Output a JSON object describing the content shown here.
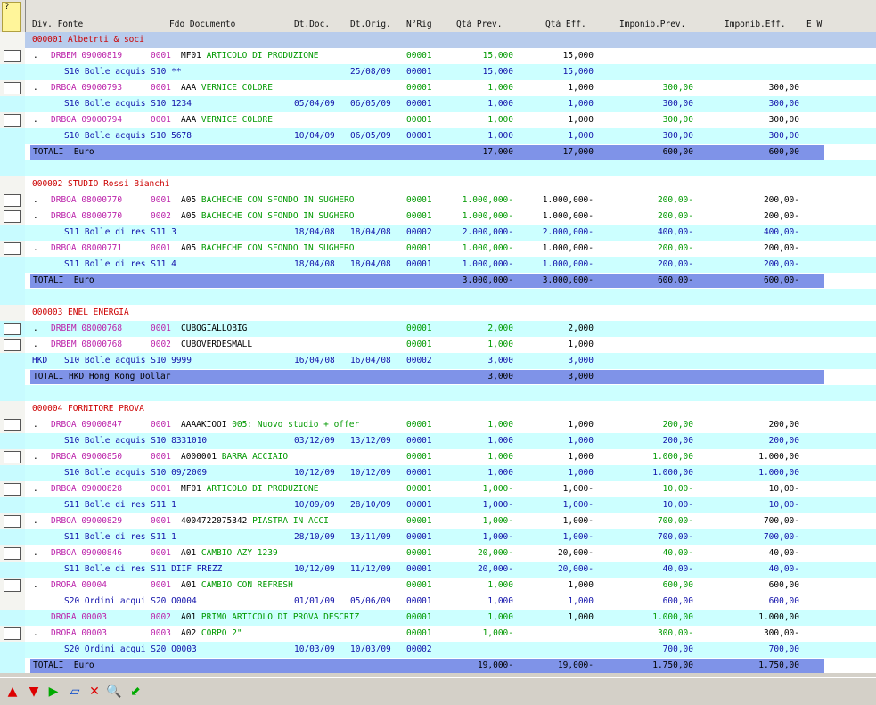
{
  "corner": "?",
  "columns": {
    "div_fonte": "Div. Fonte",
    "fdo_documento": "Fdo Documento",
    "dt_doc": "Dt.Doc.",
    "dt_orig": "Dt.Orig.",
    "n_rig": "N°Rig",
    "qta_prev": "Qtà Prev.",
    "qta_eff": "Qtà Eff.",
    "imponib_prev": "Imponib.Prev.",
    "imponib_eff": "Imponib.Eff.",
    "e_w": "E W"
  },
  "rows": [
    {
      "type": "group",
      "title": "000001 Albetrti & soci"
    },
    {
      "type": "detail",
      "bg": "white",
      "cb": true,
      "dot": ".",
      "fonte": "DRBEM 09000819",
      "rig": "0001",
      "art": "MF01",
      "desc": "ARTICOLO DI PRODUZIONE",
      "nrig": "00001",
      "qprev": "15,000",
      "qeff": "15,000",
      "iprev": "",
      "ieff": ""
    },
    {
      "type": "sub",
      "bg": "cyan",
      "div": "",
      "doc": "S10 Bolle acquis S10 **",
      "dtdoc": "",
      "dtorig": "25/08/09",
      "nrig": "00001",
      "qprev": "15,000",
      "qeff": "15,000",
      "iprev": "",
      "ieff": ""
    },
    {
      "type": "detail",
      "bg": "white",
      "cb": true,
      "dot": ".",
      "fonte": "DRBOA 09000793",
      "rig": "0001",
      "art": "AAA",
      "desc": "VERNICE COLORE",
      "nrig": "00001",
      "qprev": "1,000",
      "qeff": "1,000",
      "iprev": "300,00",
      "ieff": "300,00"
    },
    {
      "type": "sub",
      "bg": "cyan",
      "div": "",
      "doc": "S10 Bolle acquis S10 1234",
      "dtdoc": "05/04/09",
      "dtorig": "06/05/09",
      "nrig": "00001",
      "qprev": "1,000",
      "qeff": "1,000",
      "iprev": "300,00",
      "ieff": "300,00"
    },
    {
      "type": "detail",
      "bg": "white",
      "cb": true,
      "dot": ".",
      "fonte": "DRBOA 09000794",
      "rig": "0001",
      "art": "AAA",
      "desc": "VERNICE COLORE",
      "nrig": "00001",
      "qprev": "1,000",
      "qeff": "1,000",
      "iprev": "300,00",
      "ieff": "300,00"
    },
    {
      "type": "sub",
      "bg": "cyan",
      "div": "",
      "doc": "S10 Bolle acquis S10 5678",
      "dtdoc": "10/04/09",
      "dtorig": "06/05/09",
      "nrig": "00001",
      "qprev": "1,000",
      "qeff": "1,000",
      "iprev": "300,00",
      "ieff": "300,00"
    },
    {
      "type": "total",
      "label": "TOTALI  Euro",
      "qprev": "17,000",
      "qeff": "17,000",
      "iprev": "600,00",
      "ieff": "600,00"
    },
    {
      "type": "blank",
      "bg": "cyan"
    },
    {
      "type": "group2",
      "title": "000002 STUDIO Rossi Bianchi"
    },
    {
      "type": "detail",
      "bg": "white",
      "cb": true,
      "dot": ".",
      "fonte": "DRBOA 08000770",
      "rig": "0001",
      "art": "A05",
      "desc": "BACHECHE CON SFONDO IN SUGHERO",
      "nrig": "00001",
      "qprev": "1.000,000-",
      "qeff": "1.000,000-",
      "iprev": "200,00-",
      "ieff": "200,00-"
    },
    {
      "type": "detail",
      "bg": "white",
      "cb": true,
      "dot": ".",
      "fonte": "DRBOA 08000770",
      "rig": "0002",
      "art": "A05",
      "desc": "BACHECHE CON SFONDO IN SUGHERO",
      "nrig": "00001",
      "qprev": "1.000,000-",
      "qeff": "1.000,000-",
      "iprev": "200,00-",
      "ieff": "200,00-"
    },
    {
      "type": "sub",
      "bg": "cyan",
      "div": "",
      "doc": "S11 Bolle di res S11 3",
      "dtdoc": "18/04/08",
      "dtorig": "18/04/08",
      "nrig": "00002",
      "qprev": "2.000,000-",
      "qeff": "2.000,000-",
      "iprev": "400,00-",
      "ieff": "400,00-"
    },
    {
      "type": "detail",
      "bg": "white",
      "cb": true,
      "dot": ".",
      "fonte": "DRBOA 08000771",
      "rig": "0001",
      "art": "A05",
      "desc": "BACHECHE CON SFONDO IN SUGHERO",
      "nrig": "00001",
      "qprev": "1.000,000-",
      "qeff": "1.000,000-",
      "iprev": "200,00-",
      "ieff": "200,00-"
    },
    {
      "type": "sub",
      "bg": "cyan",
      "div": "",
      "doc": "S11 Bolle di res S11 4",
      "dtdoc": "18/04/08",
      "dtorig": "18/04/08",
      "nrig": "00001",
      "qprev": "1.000,000-",
      "qeff": "1.000,000-",
      "iprev": "200,00-",
      "ieff": "200,00-"
    },
    {
      "type": "total",
      "label": "TOTALI  Euro",
      "qprev": "3.000,000-",
      "qeff": "3.000,000-",
      "iprev": "600,00-",
      "ieff": "600,00-"
    },
    {
      "type": "blank",
      "bg": "cyan"
    },
    {
      "type": "group2",
      "title": "000003 ENEL ENERGIA"
    },
    {
      "type": "detail",
      "bg": "cyan",
      "cb": true,
      "dot": ".",
      "fonte": "DRBEM 08000768",
      "rig": "0001",
      "art": "CUBOGIALLOBIG",
      "desc": "",
      "nrig": "00001",
      "qprev": "2,000",
      "qeff": "2,000",
      "iprev": "",
      "ieff": ""
    },
    {
      "type": "detail",
      "bg": "white",
      "cb": true,
      "dot": ".",
      "fonte": "DRBEM 08000768",
      "rig": "0002",
      "art": "CUBOVERDESMALL",
      "desc": "",
      "nrig": "00001",
      "qprev": "1,000",
      "qeff": "1,000",
      "iprev": "",
      "ieff": ""
    },
    {
      "type": "sub",
      "bg": "cyan",
      "div": "HKD",
      "doc": "S10 Bolle acquis S10 9999",
      "dtdoc": "16/04/08",
      "dtorig": "16/04/08",
      "nrig": "00002",
      "qprev": "3,000",
      "qeff": "3,000",
      "iprev": "",
      "ieff": ""
    },
    {
      "type": "total",
      "label": "TOTALI HKD Hong Kong Dollar",
      "qprev": "3,000",
      "qeff": "3,000",
      "iprev": "",
      "ieff": ""
    },
    {
      "type": "blank",
      "bg": "cyan"
    },
    {
      "type": "group2",
      "title": "000004 FORNITORE PROVA"
    },
    {
      "type": "detail",
      "bg": "white",
      "cb": true,
      "dot": ".",
      "fonte": "DRBOA 09000847",
      "rig": "0001",
      "art": "AAAAKIOOI",
      "desc": "005: Nuovo studio + offer",
      "nrig": "00001",
      "qprev": "1,000",
      "qeff": "1,000",
      "iprev": "200,00",
      "ieff": "200,00"
    },
    {
      "type": "sub",
      "bg": "cyan",
      "div": "",
      "doc": "S10 Bolle acquis S10 8331010",
      "dtdoc": "03/12/09",
      "dtorig": "13/12/09",
      "nrig": "00001",
      "qprev": "1,000",
      "qeff": "1,000",
      "iprev": "200,00",
      "ieff": "200,00"
    },
    {
      "type": "detail",
      "bg": "white",
      "cb": true,
      "dot": ".",
      "fonte": "DRBOA 09000850",
      "rig": "0001",
      "art": "A000001",
      "desc": "BARRA ACCIAIO",
      "nrig": "00001",
      "qprev": "1,000",
      "qeff": "1,000",
      "iprev": "1.000,00",
      "ieff": "1.000,00"
    },
    {
      "type": "sub",
      "bg": "cyan",
      "div": "",
      "doc": "S10 Bolle acquis S10 09/2009",
      "dtdoc": "10/12/09",
      "dtorig": "10/12/09",
      "nrig": "00001",
      "qprev": "1,000",
      "qeff": "1,000",
      "iprev": "1.000,00",
      "ieff": "1.000,00"
    },
    {
      "type": "detail",
      "bg": "white",
      "cb": true,
      "dot": ".",
      "fonte": "DRBOA 09000828",
      "rig": "0001",
      "art": "MF01",
      "desc": "ARTICOLO DI PRODUZIONE",
      "nrig": "00001",
      "qprev": "1,000-",
      "qeff": "1,000-",
      "iprev": "10,00-",
      "ieff": "10,00-"
    },
    {
      "type": "sub",
      "bg": "cyan",
      "div": "",
      "doc": "S11 Bolle di res S11 1",
      "dtdoc": "10/09/09",
      "dtorig": "28/10/09",
      "nrig": "00001",
      "qprev": "1,000-",
      "qeff": "1,000-",
      "iprev": "10,00-",
      "ieff": "10,00-"
    },
    {
      "type": "detail",
      "bg": "white",
      "cb": true,
      "dot": ".",
      "fonte": "DRBOA 09000829",
      "rig": "0001",
      "art": "4004722075342",
      "desc": "PIASTRA IN ACCI",
      "nrig": "00001",
      "qprev": "1,000-",
      "qeff": "1,000-",
      "iprev": "700,00-",
      "ieff": "700,00-"
    },
    {
      "type": "sub",
      "bg": "cyan",
      "div": "",
      "doc": "S11 Bolle di res S11 1",
      "dtdoc": "28/10/09",
      "dtorig": "13/11/09",
      "nrig": "00001",
      "qprev": "1,000-",
      "qeff": "1,000-",
      "iprev": "700,00-",
      "ieff": "700,00-"
    },
    {
      "type": "detail",
      "bg": "white",
      "cb": true,
      "dot": ".",
      "fonte": "DRBOA 09000846",
      "rig": "0001",
      "art": "A01",
      "desc": "CAMBIO AZY 1239",
      "nrig": "00001",
      "qprev": "20,000-",
      "qeff": "20,000-",
      "iprev": "40,00-",
      "ieff": "40,00-"
    },
    {
      "type": "sub",
      "bg": "cyan",
      "div": "",
      "doc": "S11 Bolle di res S11 DIIF PREZZ",
      "dtdoc": "10/12/09",
      "dtorig": "11/12/09",
      "nrig": "00001",
      "qprev": "20,000-",
      "qeff": "20,000-",
      "iprev": "40,00-",
      "ieff": "40,00-"
    },
    {
      "type": "detail",
      "bg": "white",
      "cb": true,
      "dot": ".",
      "fonte": "DRORA 00004",
      "rig": "0001",
      "art": "A01",
      "desc": "CAMBIO CON REFRESH",
      "nrig": "00001",
      "qprev": "1,000",
      "qeff": "1,000",
      "iprev": "600,00",
      "ieff": "600,00"
    },
    {
      "type": "sub",
      "bg": "white",
      "div": "",
      "doc": "S20 Ordini acqui S20 O0004",
      "dtdoc": "01/01/09",
      "dtorig": "05/06/09",
      "nrig": "00001",
      "qprev": "1,000",
      "qeff": "1,000",
      "iprev": "600,00",
      "ieff": "600,00"
    },
    {
      "type": "detail",
      "bg": "cyan",
      "cb": false,
      "dot": "",
      "fonte": "DRORA 00003",
      "rig": "0002",
      "art": "A01",
      "desc": "PRIMO ARTICOLO DI PROVA DESCRIZ",
      "nrig": "00001",
      "qprev": "1,000",
      "qeff": "1,000",
      "iprev": "1.000,00",
      "ieff": "1.000,00"
    },
    {
      "type": "detail",
      "bg": "white",
      "cb": true,
      "dot": ".",
      "fonte": "DRORA 00003",
      "rig": "0003",
      "art": "A02",
      "desc": "CORPO 2\"",
      "nrig": "00001",
      "qprev": "1,000-",
      "qeff": "",
      "iprev": "300,00-",
      "ieff": "300,00-"
    },
    {
      "type": "sub",
      "bg": "cyan",
      "div": "",
      "doc": "S20 Ordini acqui S20 O0003",
      "dtdoc": "10/03/09",
      "dtorig": "10/03/09",
      "nrig": "00002",
      "qprev": "",
      "qeff": "",
      "iprev": "700,00",
      "ieff": "700,00"
    },
    {
      "type": "total",
      "label": "TOTALI  Euro",
      "qprev": "19,000-",
      "qeff": "19,000-",
      "iprev": "1.750,00",
      "ieff": "1.750,00"
    }
  ],
  "toolbar": [
    {
      "name": "move-up-icon",
      "glyph": "▲",
      "color": "#dd0000"
    },
    {
      "name": "move-down-icon",
      "glyph": "▼",
      "color": "#dd0000"
    },
    {
      "name": "play-icon",
      "glyph": "▶",
      "color": "#00aa00"
    },
    {
      "name": "eraser-icon",
      "glyph": "▱",
      "color": "#0044cc"
    },
    {
      "name": "delete-icon",
      "glyph": "✕",
      "color": "#dd0000"
    },
    {
      "name": "search-icon",
      "glyph": "🔍",
      "color": "#555555"
    },
    {
      "name": "export-icon",
      "glyph": "⬋",
      "color": "#00aa00"
    }
  ]
}
